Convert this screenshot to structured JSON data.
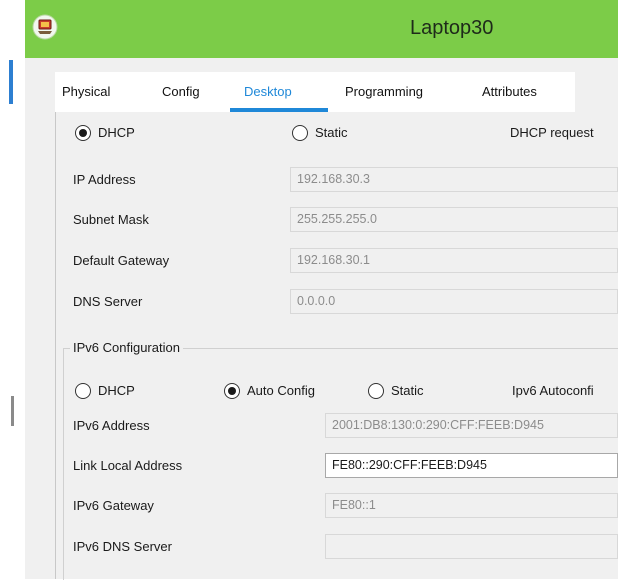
{
  "window": {
    "title": "Laptop30"
  },
  "tabs": [
    {
      "label": "Physical"
    },
    {
      "label": "Config"
    },
    {
      "label": "Desktop"
    },
    {
      "label": "Programming"
    },
    {
      "label": "Attributes"
    }
  ],
  "ipv4": {
    "mode_dhcp": "DHCP",
    "mode_static": "Static",
    "status": "DHCP request",
    "selected_mode": "DHCP",
    "ip_address": {
      "label": "IP Address",
      "value": "192.168.30.3"
    },
    "subnet_mask": {
      "label": "Subnet Mask",
      "value": "255.255.255.0"
    },
    "default_gateway": {
      "label": "Default Gateway",
      "value": "192.168.30.1"
    },
    "dns_server": {
      "label": "DNS Server",
      "value": "0.0.0.0"
    }
  },
  "ipv6": {
    "group_title": "IPv6 Configuration",
    "mode_dhcp": "DHCP",
    "mode_auto": "Auto Config",
    "mode_static": "Static",
    "status": "Ipv6 Autoconfi",
    "selected_mode": "Auto Config",
    "address": {
      "label": "IPv6 Address",
      "value": "2001:DB8:130:0:290:CFF:FEEB:D945"
    },
    "link_local": {
      "label": "Link Local Address",
      "value": "FE80::290:CFF:FEEB:D945"
    },
    "gateway": {
      "label": "IPv6 Gateway",
      "value": "FE80::1"
    },
    "dns_server": {
      "label": "IPv6 DNS Server",
      "value": ""
    }
  },
  "colors": {
    "titlebar": "#7ccc48",
    "active_tab": "#1f88d8",
    "panel": "#f0f0f0"
  },
  "icons": {
    "app": "laptop-app-icon"
  }
}
